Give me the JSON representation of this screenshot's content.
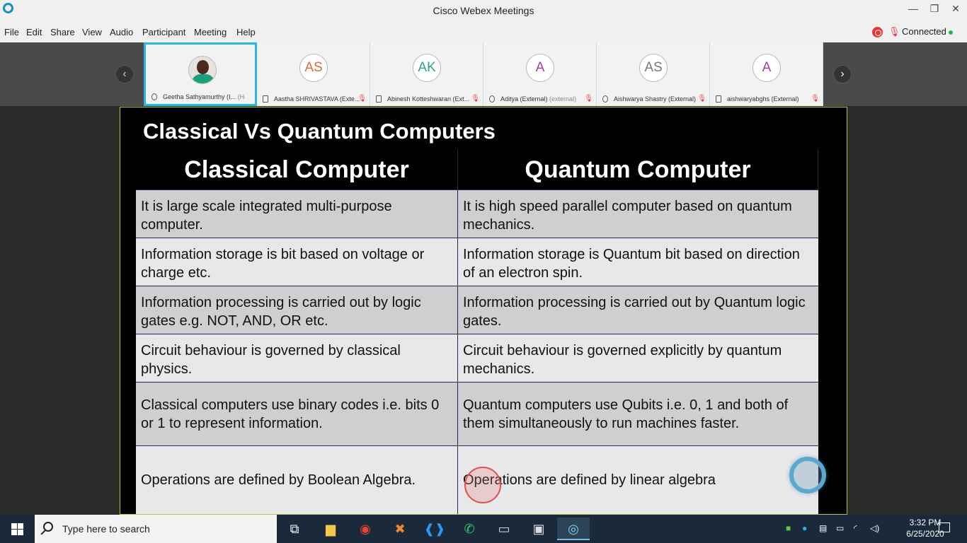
{
  "window": {
    "title": "Cisco Webex Meetings",
    "minimize": "—",
    "maximize": "❐",
    "close": "✕"
  },
  "menu": {
    "items": [
      "File",
      "Edit",
      "Share",
      "View",
      "Audio",
      "Participant",
      "Meeting",
      "Help"
    ],
    "status": "Connected"
  },
  "participants": [
    {
      "name": "Geetha Sathyamurthy (I...",
      "tag": "(Host...",
      "initials": "",
      "color": "#333333"
    },
    {
      "name": "Aastha SHRIVASTAVA (Exte...",
      "tag": "",
      "initials": "AS",
      "color": "#e2683c"
    },
    {
      "name": "Abinesh Kotteshwaran (Ext...",
      "tag": "",
      "initials": "AK",
      "color": "#2aa38a"
    },
    {
      "name": "Aditya (External)",
      "tag": "(external)",
      "initials": "A",
      "color": "#a23aa8"
    },
    {
      "name": "Aishwarya Shastry (External)",
      "tag": "",
      "initials": "AS",
      "color": "#777777"
    },
    {
      "name": "aishwaryabghs (External)",
      "tag": "",
      "initials": "A",
      "color": "#a23aa8"
    }
  ],
  "slide": {
    "title": "Classical Vs Quantum Computers",
    "headers": [
      "Classical Computer",
      "Quantum Computer"
    ],
    "rows": [
      [
        "It is large scale integrated multi-purpose computer.",
        "It is high speed parallel computer based on quantum mechanics."
      ],
      [
        "Information storage is bit based on voltage or charge etc.",
        "Information storage is Quantum bit based on direction of an electron spin."
      ],
      [
        "Information processing is carried out by logic gates e.g. NOT, AND, OR etc.",
        "Information processing is carried out by Quantum logic gates."
      ],
      [
        "Circuit behaviour is governed by classical physics.",
        "Circuit behaviour is governed explicitly by quantum mechanics."
      ],
      [
        "Classical computers use binary codes i.e. bits 0 or 1 to represent information.",
        "Quantum computers use Qubits i.e. 0, 1 and both of them simultaneously to run machines faster."
      ],
      [
        "Operations are defined by Boolean Algebra.",
        "Operations are defined by linear algebra"
      ]
    ]
  },
  "taskbar": {
    "search_placeholder": "Type here to search",
    "time": "3:32 PM",
    "date": "6/25/2020"
  }
}
